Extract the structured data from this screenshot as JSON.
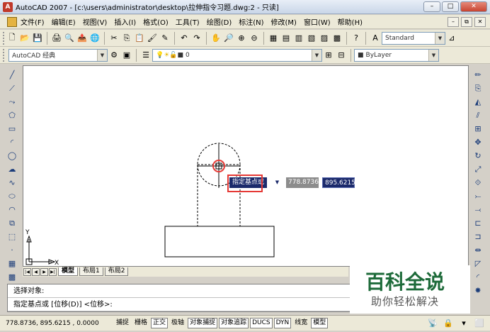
{
  "window": {
    "app_letter": "A",
    "title": "AutoCAD 2007 - [c:\\users\\administrator\\desktop\\拉伸指令习题.dwg:2 - 只读]",
    "minimize": "–",
    "maximize": "□",
    "close": "✕"
  },
  "menu": {
    "items": [
      "文件(F)",
      "编辑(E)",
      "视图(V)",
      "插入(I)",
      "格式(O)",
      "工具(T)",
      "绘图(D)",
      "标注(N)",
      "修改(M)",
      "窗口(W)",
      "帮助(H)"
    ],
    "doc_minimize": "–",
    "doc_restore": "⧉",
    "doc_close": "✕"
  },
  "toolbar": {
    "text_style": "Standard",
    "workspace": "AutoCAD 经典",
    "layer": "0",
    "linetype_color": "ByLayer"
  },
  "dynamic_input": {
    "prompt": "指定基点或",
    "x_value": "778.8736",
    "y_value": "895.6215"
  },
  "ucs": {
    "x_label": "X",
    "y_label": "Y"
  },
  "tabs": {
    "model": "模型",
    "layout1": "布局1",
    "layout2": "布局2"
  },
  "command": {
    "line1": "选择对象:",
    "line2": "指定基点或 [位移(D)] <位移>:"
  },
  "status": {
    "coords": "778.8736,  895.6215 , 0.0000",
    "buttons": [
      {
        "label": "捕捉",
        "on": false
      },
      {
        "label": "栅格",
        "on": false
      },
      {
        "label": "正交",
        "on": true
      },
      {
        "label": "极轴",
        "on": false
      },
      {
        "label": "对象捕捉",
        "on": true
      },
      {
        "label": "对象追踪",
        "on": true
      },
      {
        "label": "DUCS",
        "on": true
      },
      {
        "label": "DYN",
        "on": true
      },
      {
        "label": "线宽",
        "on": false
      },
      {
        "label": "模型",
        "on": true
      }
    ]
  },
  "watermark": {
    "main": "百科全说",
    "sub": "助你轻松解决"
  }
}
